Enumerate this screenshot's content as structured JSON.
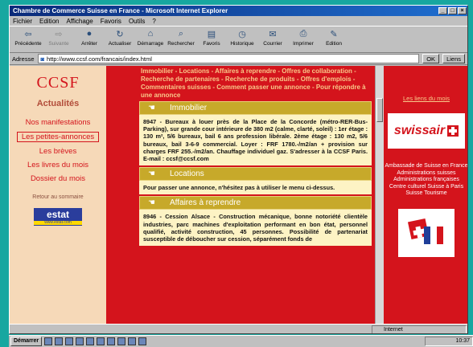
{
  "window": {
    "title": "Chambre de Commerce Suisse en France - Microsoft Internet Explorer"
  },
  "menu": [
    "Fichier",
    "Edition",
    "Affichage",
    "Favoris",
    "Outils",
    "?"
  ],
  "toolbar": [
    {
      "label": "Précédente",
      "icon": "back-arrow-icon",
      "enabled": true
    },
    {
      "label": "Suivante",
      "icon": "forward-arrow-icon",
      "enabled": false
    },
    {
      "label": "Arrêter",
      "icon": "stop-icon",
      "enabled": true
    },
    {
      "label": "Actualiser",
      "icon": "refresh-icon",
      "enabled": true
    },
    {
      "label": "Démarrage",
      "icon": "home-icon",
      "enabled": true
    },
    {
      "label": "Rechercher",
      "icon": "search-icon",
      "enabled": true
    },
    {
      "label": "Favoris",
      "icon": "favorites-icon",
      "enabled": true
    },
    {
      "label": "Historique",
      "icon": "history-icon",
      "enabled": true
    },
    {
      "label": "Courrier",
      "icon": "mail-icon",
      "enabled": true
    },
    {
      "label": "Imprimer",
      "icon": "print-icon",
      "enabled": true
    },
    {
      "label": "Edition",
      "icon": "edit-icon",
      "enabled": true
    }
  ],
  "address": {
    "label": "Adresse",
    "url": "http://www.ccsf.com/francais/index.html",
    "go": "OK",
    "links": "Liens"
  },
  "left": {
    "logo": "CCSF",
    "heading": "Actualités",
    "nav": [
      {
        "label": "Nos manifestations",
        "selected": false
      },
      {
        "label": "Les petites-annonces",
        "selected": true
      },
      {
        "label": "Les brèves",
        "selected": false
      },
      {
        "label": "Les livres du mois",
        "selected": false
      },
      {
        "label": "Dossier du mois",
        "selected": false
      }
    ],
    "back": "Retour au sommaire",
    "estat": "estat",
    "estat_url": "www.estat.com"
  },
  "center": {
    "top_links": "Immobilier - Locations - Affaires à reprendre - Offres de collaboration - Recherche de partenaires - Recherche de produits - Offres d'emplois - Commentaires suisses - Comment passer une annonce - Pour répondre à une annonce",
    "sections": [
      {
        "title": "Immobilier",
        "body": "8947 - Bureaux à louer près de la Place de la Concorde (métro-RER-Bus-Parking), sur grande cour intérieure de 380 m2 (calme, clarté, soleil) : 1er étage : 130 m², 5/6 bureaux, bail 6 ans profession libérale. 2ème étage : 130 m2, 5/6 bureaux, bail 3-6-9 commercial. Loyer : FRF 1780.-/m2/an + provision sur charges FRF 255.-/m2/an. Chauffage individuel gaz. S'adresser à la CCSF Paris. E-mail : ccsf@ccsf.com"
      },
      {
        "title": "Locations",
        "body": "Pour passer une annonce, n'hésitez pas à utiliser le menu ci-dessus."
      },
      {
        "title": "Affaires à reprendre",
        "body": "8946 - Cession Alsace - Construction mécanique, bonne notoriété clientèle industries, parc machines d'exploitation performant en bon état, personnel qualifié, activité construction, 45 personnes. Possibilité de partenariat susceptible de déboucher sur cession, séparément fonds de"
      }
    ]
  },
  "right": {
    "link": "Les liens du mois",
    "banner": "swissair",
    "links": [
      "Ambassade de Suisse en France",
      "Administrations suisses",
      "Administrations françaises",
      "Centre culturel Suisse à Paris",
      "Suisse Tourisme"
    ]
  },
  "status": {
    "left": "",
    "zone": "Internet"
  },
  "taskbar": {
    "start": "Démarrer",
    "clock": "10:37"
  }
}
